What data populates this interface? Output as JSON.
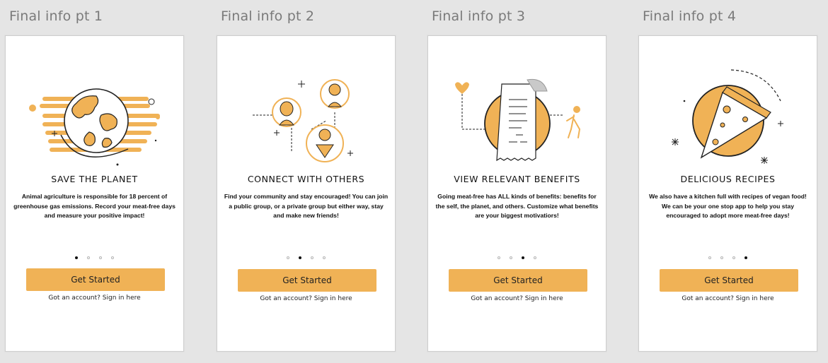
{
  "brand": {
    "accent": "#f0b256",
    "dark": "#222222"
  },
  "screens": [
    {
      "label": "Final info pt 1",
      "illustration": "earth-icon",
      "title": "SAVE THE PLANET",
      "description": "Animal agriculture is responsible for 18 percent of greenhouse gas emissions. Record your meat-free days and measure your positive impact!",
      "active_dot": 0,
      "button": "Get Started",
      "signin": "Got an account? Sign in here"
    },
    {
      "label": "Final info pt 2",
      "illustration": "people-network-icon",
      "title": "CONNECT WITH OTHERS",
      "description": "Find your community and stay encouraged! You can join a public group, or a private group but either way, stay and make new friends!",
      "active_dot": 1,
      "button": "Get Started",
      "signin": "Got an account? Sign in here"
    },
    {
      "label": "Final info pt 3",
      "illustration": "receipt-benefits-icon",
      "title": "VIEW RELEVANT BENEFITS",
      "description": "Going meat-free has ALL kinds of benefits: benefits for the self, the planet, and others. Customize what benefits are your biggest motivatiors!",
      "active_dot": 2,
      "button": "Get Started",
      "signin": "Got an account? Sign in here"
    },
    {
      "label": "Final info pt 4",
      "illustration": "pizza-slice-icon",
      "title": "DELICIOUS RECIPES",
      "description": "We also have a kitchen full with recipes of vegan food! We can be your one stop app to help you stay encouraged to adopt more meat-free days!",
      "active_dot": 3,
      "button": "Get Started",
      "signin": "Got an account? Sign in here"
    }
  ]
}
